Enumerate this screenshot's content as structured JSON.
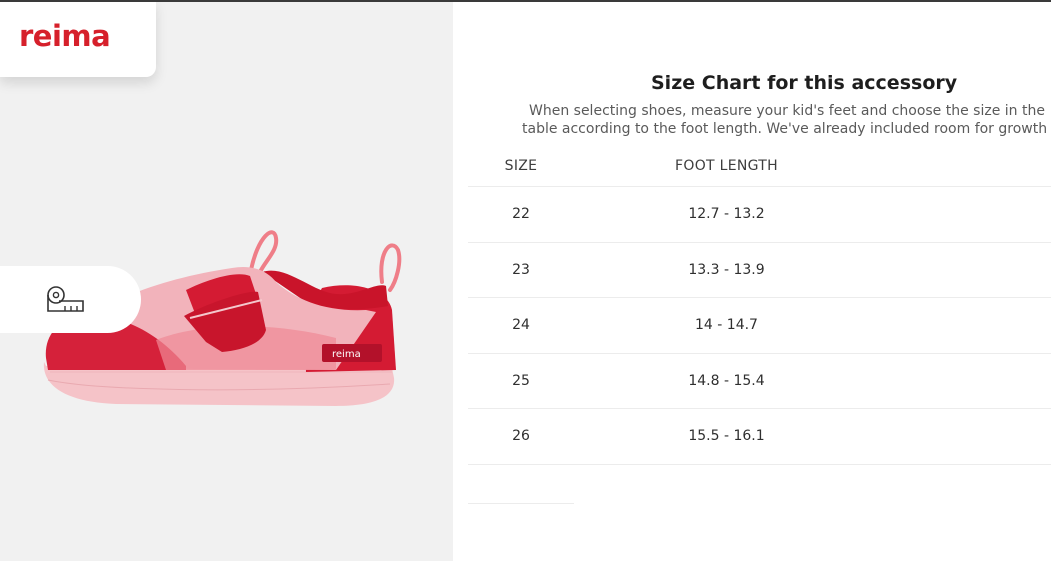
{
  "brand": {
    "logo_text": "reima",
    "accent_color": "#d6202b"
  },
  "product": {
    "size_guide_icon": "measuring-tape-icon"
  },
  "size_chart": {
    "title": "Size Chart for this accessory",
    "description_line1": "When selecting shoes, measure your kid's feet and choose the size in the",
    "description_line2": "table according to the foot length. We've already included room for growth",
    "headers": {
      "size": "SIZE",
      "foot_length": "FOOT LENGTH"
    },
    "rows": [
      {
        "size": "22",
        "foot_length": "12.7 - 13.2"
      },
      {
        "size": "23",
        "foot_length": "13.3 - 13.9"
      },
      {
        "size": "24",
        "foot_length": "14 - 14.7"
      },
      {
        "size": "25",
        "foot_length": "14.8 - 15.4"
      },
      {
        "size": "26",
        "foot_length": "15.5 - 16.1"
      }
    ]
  }
}
